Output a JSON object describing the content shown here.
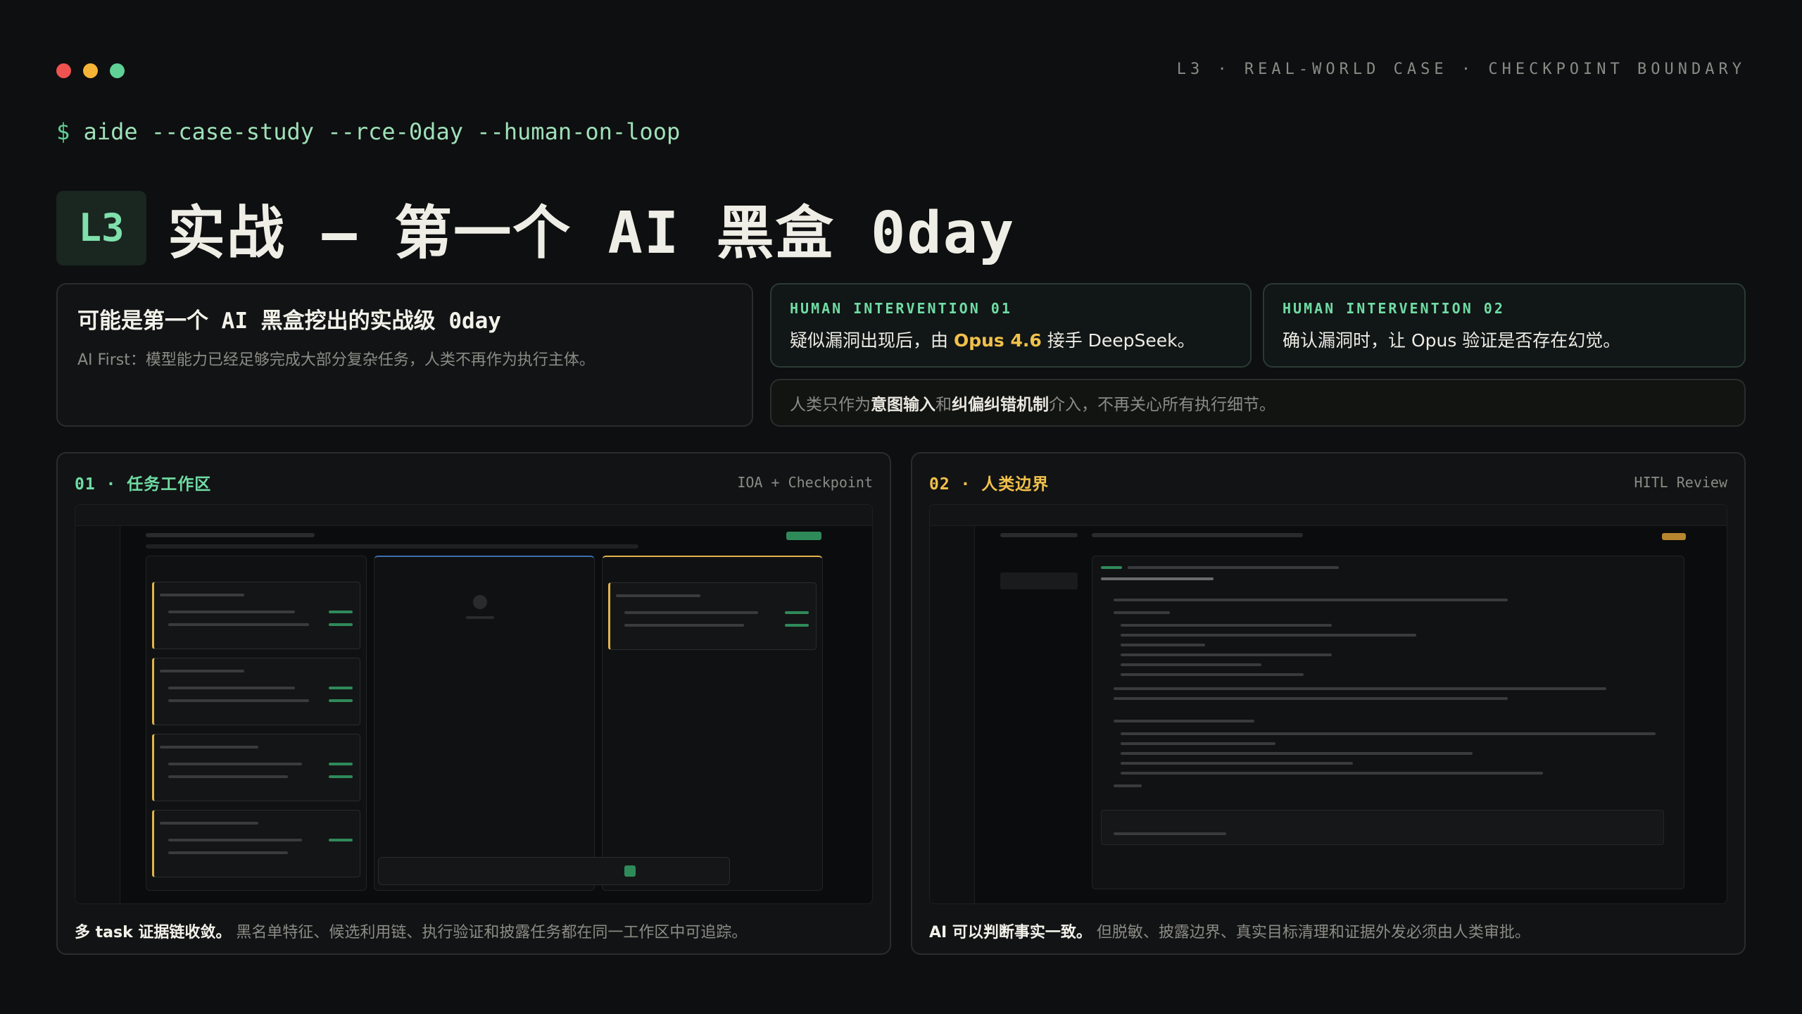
{
  "window": {
    "dot_colors": [
      "#ef5350",
      "#f4b536",
      "#5fd196"
    ],
    "kicker": "L3 · REAL-WORLD CASE · CHECKPOINT BOUNDARY"
  },
  "command": {
    "prompt": "$",
    "text": "aide --case-study --rce-0day --human-on-loop"
  },
  "heading": {
    "badge": "L3",
    "title": "实战 — 第一个 AI 黑盒 0day"
  },
  "main_card": {
    "title": "可能是第一个 AI 黑盒挖出的实战级 0day",
    "subtitle": "AI First：模型能力已经足够完成大部分复杂任务，人类不再作为执行主体。"
  },
  "interventions": [
    {
      "label": "HUMAN INTERVENTION 01",
      "text_before": "疑似漏洞出现后，由 ",
      "highlight": "Opus 4.6",
      "text_after": " 接手 DeepSeek。"
    },
    {
      "label": "HUMAN INTERVENTION 02",
      "text": "确认漏洞时，让 Opus 验证是否存在幻觉。"
    }
  ],
  "note": {
    "part1": "人类只作为",
    "bold1": "意图输入",
    "part2": "和",
    "bold2": "纠偏纠错机制",
    "part3": "介入，不再关心所有执行细节。"
  },
  "panels": [
    {
      "title": "01 · 任务工作区",
      "title_color": "#6fdca4",
      "tag": "IOA + Checkpoint",
      "caption_bold": "多 task 证据链收敛。",
      "caption": "黑名单特征、候选利用链、执行验证和披露任务都在同一工作区中可追踪。"
    },
    {
      "title": "02 · 人类边界",
      "title_color": "#f1c14b",
      "tag": "HITL Review",
      "caption_bold": "AI 可以判断事实一致。",
      "caption": "但脱敏、披露边界、真实目标清理和证据外发必须由人类审批。"
    }
  ]
}
